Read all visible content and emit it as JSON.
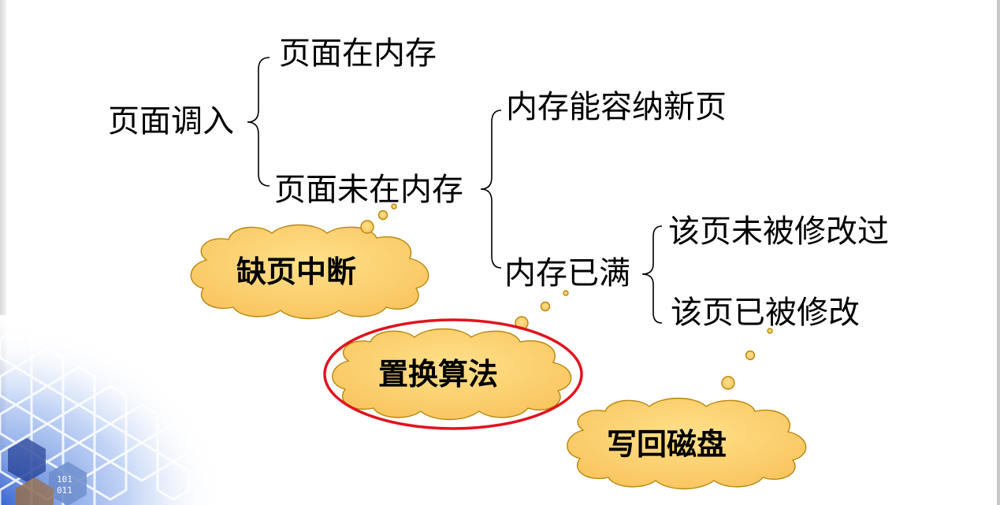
{
  "colors": {
    "cloud_fill": "#FFCC66",
    "cloud_stroke": "#B8860B",
    "highlight_ring": "#E0141E",
    "brace": "#000000",
    "hex_pattern": "#3A6FD8"
  },
  "nodes": {
    "root": "页面调入",
    "in_memory": "页面在内存",
    "not_in_memory": "页面未在内存",
    "memory_has_space": "内存能容纳新页",
    "memory_full": "内存已满",
    "page_not_modified": "该页未被修改过",
    "page_modified": "该页已被修改"
  },
  "clouds": {
    "page_fault": "缺页中断",
    "replacement": "置换算法",
    "write_back": "写回磁盘"
  }
}
